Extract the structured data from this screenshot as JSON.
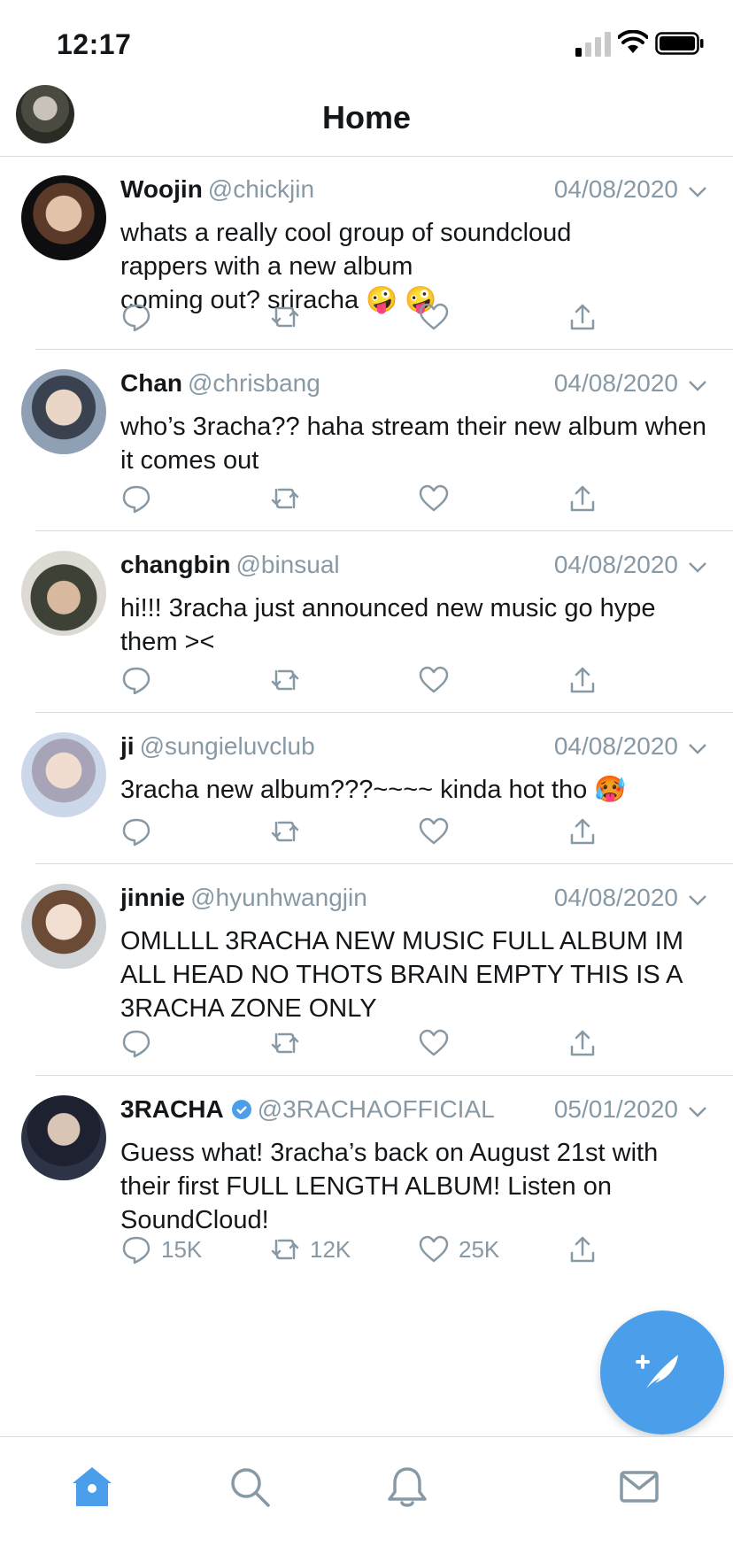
{
  "status": {
    "time": "12:17"
  },
  "header": {
    "title": "Home"
  },
  "tweets": [
    {
      "name": "Woojin",
      "handle": "@chickjin",
      "date": "04/08/2020",
      "verified": false,
      "text": "whats a really cool group of soundcloud rappers with a new album\ncoming out? sriracha 🤪 🤪",
      "counts": {
        "reply": "",
        "retweet": "",
        "like": ""
      }
    },
    {
      "name": "Chan",
      "handle": "@chrisbang",
      "date": "04/08/2020",
      "verified": false,
      "text": "who’s 3racha?? haha stream their new album when it comes out",
      "counts": {
        "reply": "",
        "retweet": "",
        "like": ""
      }
    },
    {
      "name": "changbin",
      "handle": "@binsual",
      "date": "04/08/2020",
      "verified": false,
      "text": "hi!!! 3racha just announced new music go hype them ><",
      "counts": {
        "reply": "",
        "retweet": "",
        "like": ""
      }
    },
    {
      "name": "ji",
      "handle": "@sungieluvclub",
      "date": "04/08/2020",
      "verified": false,
      "text": "3racha new album???~~~~ kinda hot tho 🥵",
      "counts": {
        "reply": "",
        "retweet": "",
        "like": ""
      }
    },
    {
      "name": "jinnie",
      "handle": "@hyunhwangjin",
      "date": "04/08/2020",
      "verified": false,
      "text": "OMLLLL 3RACHA NEW MUSIC FULL ALBUM IM ALL HEAD NO THOTS BRAIN EMPTY THIS IS A 3RACHA ZONE ONLY",
      "counts": {
        "reply": "",
        "retweet": "",
        "like": ""
      }
    },
    {
      "name": "3RACHA",
      "handle": "@3RACHAOFFICIAL",
      "date": "05/01/2020",
      "verified": true,
      "text": "Guess what! 3racha’s back on August 21st with their first FULL LENGTH ALBUM! Listen on SoundCloud!",
      "counts": {
        "reply": "15K",
        "retweet": "12K",
        "like": "25K"
      }
    }
  ],
  "icons": {
    "compose": "compose-feather-icon",
    "tabs": [
      "home-icon",
      "search-icon",
      "bell-icon",
      "mail-icon"
    ]
  },
  "colors": {
    "accent": "#4a9eea",
    "muted": "#8899a6",
    "text": "#14171a",
    "divider": "#d9dcdf"
  }
}
